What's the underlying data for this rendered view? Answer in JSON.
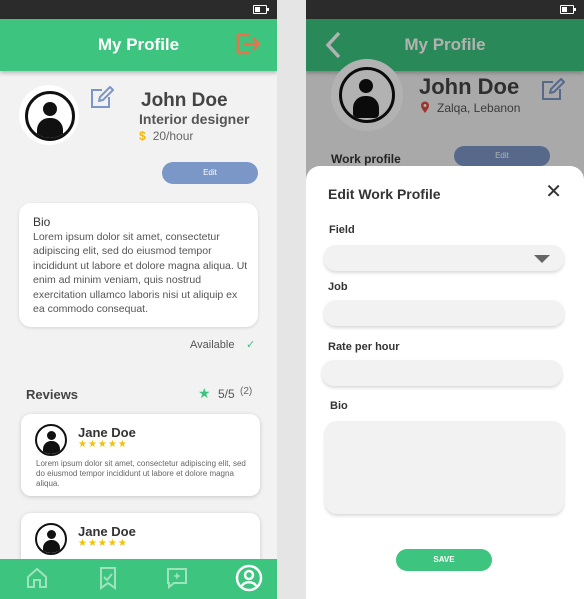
{
  "colors": {
    "accent": "#3dc47e",
    "edit_button": "#7b97c8",
    "star": "#f2c200",
    "logout": "#e8734a",
    "location_pin": "#e04b3c"
  },
  "left_screen": {
    "appbar": {
      "title": "My Profile",
      "logout_icon": "logout-icon"
    },
    "profile": {
      "name": "John Doe",
      "job": "Interior designer",
      "currency": "$",
      "rate": "20/hour",
      "edit_icon": "edit-icon",
      "edit_button": "Edit"
    },
    "bio": {
      "title": "Bio",
      "text": "Lorem ipsum dolor sit amet, consectetur adipiscing elit, sed do eiusmod tempor incididunt ut labore et dolore magna aliqua. Ut enim ad minim veniam, quis nostrud exercitation ullamco laboris nisi ut aliquip ex ea commodo consequat."
    },
    "availability": {
      "label": "Available",
      "check": "✓"
    },
    "reviews": {
      "title": "Reviews",
      "rating": "5/5",
      "count": "(2)",
      "items": [
        {
          "name": "Jane Doe",
          "stars": 5,
          "stars_text": "★★★★★",
          "text": "Lorem ipsum dolor sit amet, consectetur adipiscing elit, sed do eiusmod tempor incididunt ut labore et dolore magna aliqua."
        },
        {
          "name": "Jane Doe",
          "stars": 5,
          "stars_text": "★★★★★"
        }
      ]
    },
    "bottom_nav": [
      "home-icon",
      "bookmark-icon",
      "chat-icon",
      "profile-icon"
    ]
  },
  "right_screen": {
    "appbar": {
      "title": "My Profile",
      "back_icon": "back-icon"
    },
    "profile": {
      "name": "John Doe",
      "location": "Zalqa, Lebanon",
      "section_label": "Work profile",
      "edit_button": "Edit"
    },
    "sheet": {
      "title": "Edit Work Profile",
      "close": "✕",
      "fields": [
        {
          "label": "Field",
          "value": "",
          "type": "select"
        },
        {
          "label": "Job",
          "value": "",
          "type": "text"
        },
        {
          "label": "Rate per hour",
          "value": "",
          "type": "text"
        },
        {
          "label": "Bio",
          "value": "",
          "type": "textarea"
        }
      ],
      "save_button": "SAVE"
    }
  }
}
